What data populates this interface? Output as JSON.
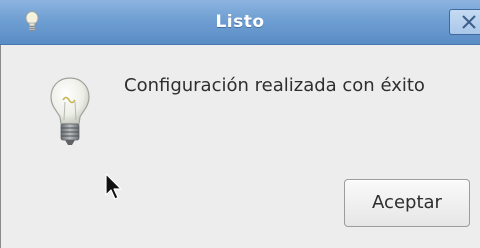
{
  "window": {
    "title": "Listo",
    "title_icon": "lightbulb-icon",
    "close_icon": "close-icon",
    "titlebar_color": "#6f9fd3"
  },
  "dialog": {
    "icon": "lightbulb-icon",
    "message": "Configuración realizada con éxito",
    "ok_label": "Aceptar",
    "background_color": "#ededed"
  },
  "pointer": {
    "icon": "mouse-pointer-icon"
  }
}
